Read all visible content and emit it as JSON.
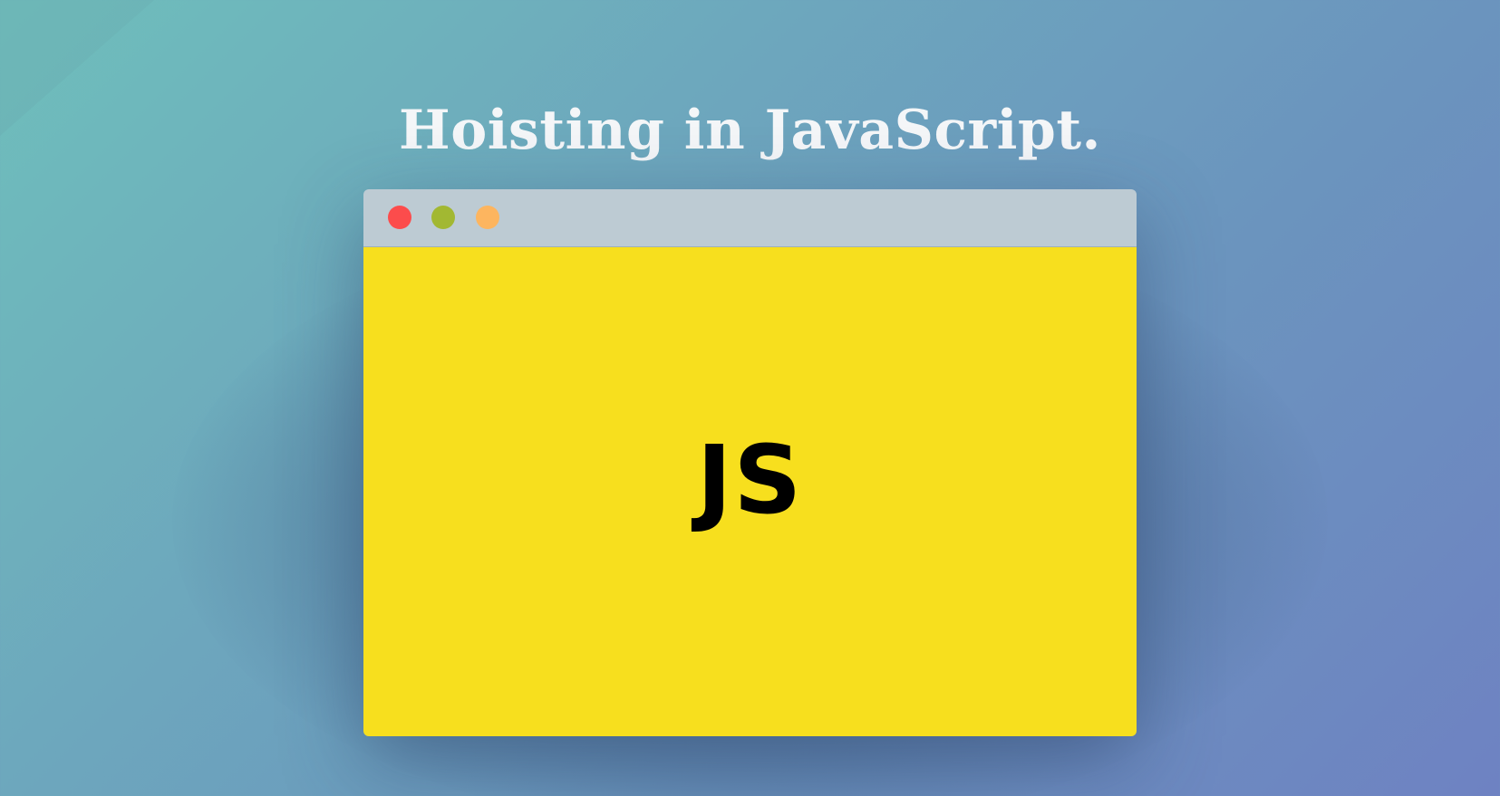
{
  "header": {
    "title": "Hoisting in JavaScript."
  },
  "window": {
    "logo_text": "JS",
    "controls": {
      "close_color": "#fc4c4c",
      "minimize_color": "#a2b832",
      "maximize_color": "#fdb55f"
    },
    "titlebar_color": "#bdcbd3",
    "content_color": "#f7df1e"
  },
  "background": {
    "gradient_start": "#6fbfbb",
    "gradient_end": "#6e82c2"
  }
}
